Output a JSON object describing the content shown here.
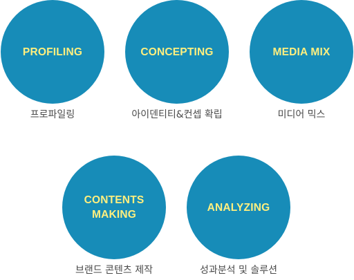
{
  "colors": {
    "circle_fill": "#178cb8",
    "title_text": "#ffef7f",
    "caption_text": "#4a4a4a",
    "background": "#ffffff"
  },
  "steps": [
    {
      "title": "PROFILING",
      "caption": "프로파일링"
    },
    {
      "title": "CONCEPTING",
      "caption": "아이덴티티&컨셉 확립"
    },
    {
      "title": "MEDIA MIX",
      "caption": "미디어 믹스"
    },
    {
      "title": "CONTENTS\nMAKING",
      "caption": "브랜드 콘텐츠 제작"
    },
    {
      "title": "ANALYZING",
      "caption": "성과분석 및 솔루션"
    }
  ]
}
